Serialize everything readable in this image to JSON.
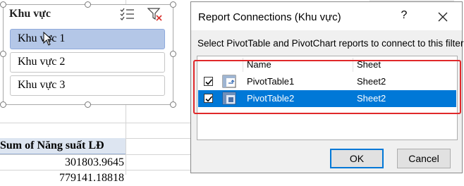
{
  "sheet": {
    "pivot_header": "Sum of Năng suất LĐ",
    "pivot_values": [
      "301803.9645",
      "779141.18818"
    ]
  },
  "slicer": {
    "title": "Khu vực",
    "items": [
      {
        "label": "Khu vực 1",
        "selected": true
      },
      {
        "label": "Khu vực 2",
        "selected": false
      },
      {
        "label": "Khu vực 3",
        "selected": false
      }
    ],
    "icons": [
      "multi-select-icon",
      "clear-filter-icon"
    ]
  },
  "dialog": {
    "title": "Report Connections (Khu vực)",
    "help": "?",
    "description": "Select PivotTable and PivotChart reports to connect to this filter",
    "columns": {
      "name": "Name",
      "sheet": "Sheet"
    },
    "rows": [
      {
        "name": "PivotTable1",
        "sheet": "Sheet2",
        "checked": true,
        "selected": false
      },
      {
        "name": "PivotTable2",
        "sheet": "Sheet2",
        "checked": true,
        "selected": true
      }
    ],
    "buttons": {
      "ok": "OK",
      "cancel": "Cancel"
    }
  },
  "colors": {
    "selection": "#0078d7",
    "slicer_selected": "#b4c7e7",
    "highlight_box": "#e0282a",
    "pivot_header_bg": "#dde5f1"
  }
}
